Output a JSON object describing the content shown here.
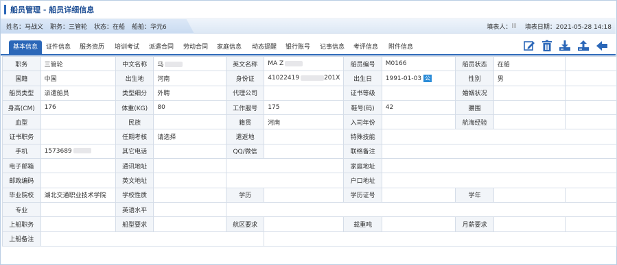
{
  "title": "船员管理 - 船员详细信息",
  "info": {
    "name": "姓名：马战义",
    "post": "职务：三管轮",
    "status": "状态：在船",
    "ship": "船舶：华元6",
    "filler": "填表人：",
    "filler_value": "lll",
    "date": "填表日期：2021-05-28 14:18"
  },
  "tabs": [
    "基本信息",
    "证件信息",
    "服务资历",
    "培训考试",
    "派遣合同",
    "劳动合同",
    "家庭信息",
    "动态提醒",
    "银行账号",
    "记事信息",
    "考评信息",
    "附件信息"
  ],
  "toolbar": [
    "edit-icon",
    "delete-icon",
    "download-icon",
    "upload-icon",
    "back-arrow-icon"
  ],
  "colors": {
    "accent": "#2b67b8",
    "label_bg": "#f2f5f9",
    "border": "#d5dde8"
  },
  "rows": [
    [
      [
        "职务",
        "三管轮"
      ],
      [
        "中文名称",
        "马"
      ],
      [
        "英文名称",
        "MA Z"
      ],
      [
        "船员编号",
        "M0166"
      ],
      [
        "船员状态",
        "在船"
      ]
    ],
    [
      [
        "国籍",
        "中国"
      ],
      [
        "出生地",
        "河南"
      ],
      [
        "身份证",
        "41022419",
        "201X"
      ],
      [
        "出生日",
        "1991-01-03"
      ],
      [
        "性别",
        "男"
      ]
    ],
    [
      [
        "船员类型",
        "派遣船员"
      ],
      [
        "类型细分",
        "外聘"
      ],
      [
        "代理公司",
        ""
      ],
      [
        "证书等级",
        ""
      ],
      [
        "婚姻状况",
        ""
      ]
    ],
    [
      [
        "身高(CM)",
        "176"
      ],
      [
        "体重(KG)",
        "80"
      ],
      [
        "工作服号",
        "175"
      ],
      [
        "鞋号(码)",
        "42"
      ],
      [
        "腰围",
        ""
      ]
    ],
    [
      [
        "血型",
        ""
      ],
      [
        "民族",
        ""
      ],
      [
        "籍贯",
        "河南"
      ],
      [
        "入司年份",
        ""
      ],
      [
        "航海经验",
        ""
      ]
    ],
    [
      [
        "证书职务",
        ""
      ],
      [
        "任期考核",
        "请选择"
      ],
      [
        "遣返地",
        ""
      ],
      [
        "特殊技能",
        ""
      ]
    ],
    [
      [
        "手机",
        "1573689"
      ],
      [
        "其它电话",
        ""
      ],
      [
        "QQ/微信",
        ""
      ],
      [
        "联络备注",
        ""
      ]
    ],
    [
      [
        "电子邮箱",
        ""
      ],
      [
        "通讯地址",
        ""
      ],
      [
        "家庭地址",
        ""
      ]
    ],
    [
      [
        "邮政编码",
        ""
      ],
      [
        "英文地址",
        ""
      ],
      [
        "户口地址",
        ""
      ]
    ],
    [
      [
        "毕业院校",
        "湖北交通职业技术学院"
      ],
      [
        "学校性质",
        ""
      ],
      [
        "学历",
        ""
      ],
      [
        "学历证号",
        ""
      ],
      [
        "学年",
        ""
      ]
    ],
    [
      [
        "专业",
        ""
      ],
      [
        "英语水平",
        ""
      ]
    ],
    [
      [
        "上船职务",
        ""
      ],
      [
        "船型要求",
        ""
      ],
      [
        "航区要求",
        ""
      ],
      [
        "载重吨",
        ""
      ],
      [
        "月薪要求",
        ""
      ]
    ],
    [
      [
        "上船备注",
        ""
      ]
    ]
  ],
  "calendar_badge": "公"
}
